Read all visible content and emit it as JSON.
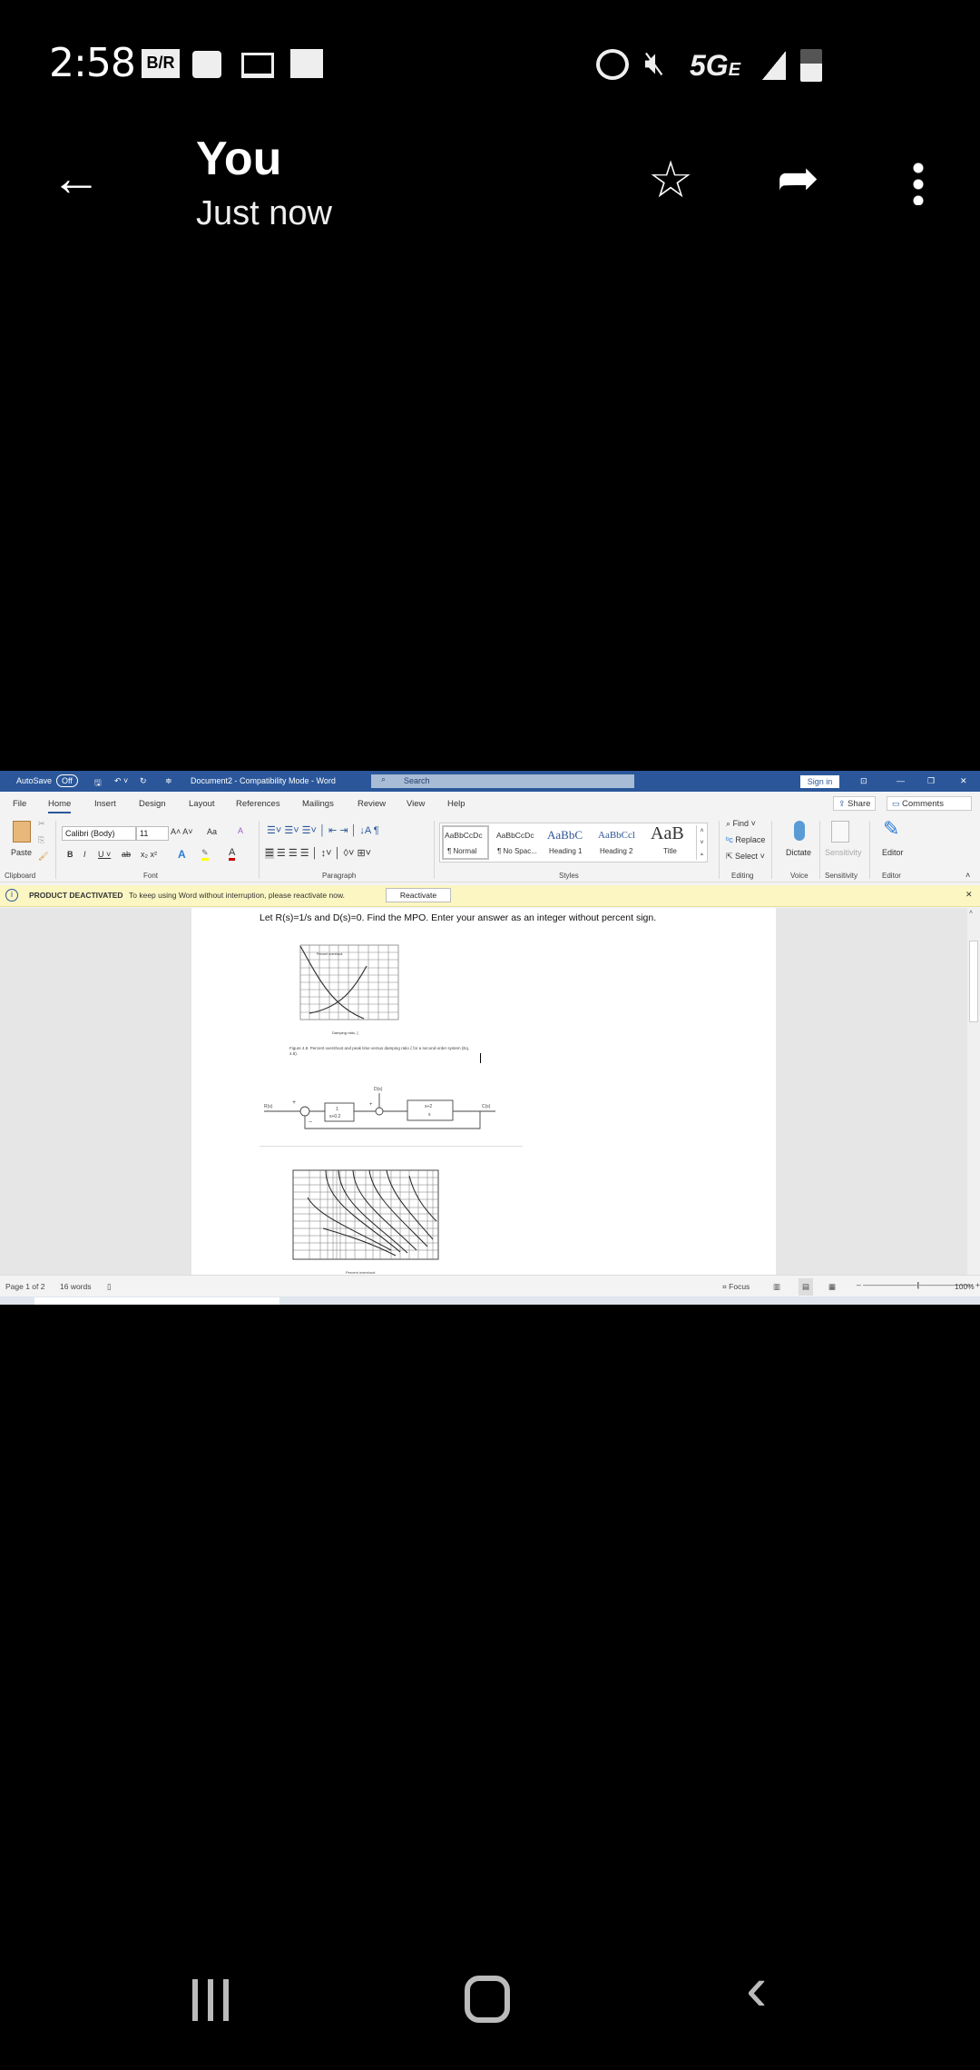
{
  "status_bar": {
    "time": "2:58",
    "network": "5G",
    "network_suffix": "E",
    "icons": [
      "br-app-icon",
      "email-icon",
      "laptop-icon",
      "image-icon",
      "alarm-icon",
      "mute-icon",
      "signal-icon",
      "battery-icon"
    ],
    "br_label": "B/R"
  },
  "header": {
    "title": "You",
    "subtitle": "Just now",
    "icons": [
      "back-arrow-icon",
      "star-icon",
      "forward-icon",
      "more-vert-icon"
    ]
  },
  "word": {
    "titlebar": {
      "autosave": "AutoSave",
      "autosave_state": "Off",
      "doc_title": "Document2  -  Compatibility Mode  -  Word",
      "search": "Search",
      "sign_in": "Sign in"
    },
    "tabs": [
      "File",
      "Home",
      "Insert",
      "Design",
      "Layout",
      "References",
      "Mailings",
      "Review",
      "View",
      "Help"
    ],
    "active_tab": "Home",
    "share": "Share",
    "comments": "Comments",
    "ribbon": {
      "paste": "Paste",
      "font_name": "Calibri (Body)",
      "font_size": "11",
      "change_case": "Aa",
      "groups": [
        "Clipboard",
        "Font",
        "Paragraph",
        "Styles",
        "Editing",
        "Voice",
        "Sensitivity",
        "Editor"
      ],
      "styles": [
        {
          "preview": "AaBbCcDc",
          "label": "¶ Normal"
        },
        {
          "preview": "AaBbCcDc",
          "label": "¶ No Spac..."
        },
        {
          "preview": "AaBbC",
          "label": "Heading 1"
        },
        {
          "preview": "AaBbCcl",
          "label": "Heading 2"
        },
        {
          "preview": "AaB",
          "label": "Title"
        }
      ],
      "editing": [
        "Find",
        "Replace",
        "Select"
      ],
      "dictate": "Dictate",
      "sensitivity": "Sensitivity",
      "editor": "Editor"
    },
    "banner": {
      "title": "PRODUCT DEACTIVATED",
      "message": "To keep using Word without interruption, please reactivate now.",
      "button": "Reactivate"
    },
    "document": {
      "question": "Let R(s)=1/s and D(s)=0. Find the MPO. Enter your answer as an integer without percent sign.",
      "figure1_caption": "Figure 4.8.  Percent overshoot and peak time versus damping ratio ζ for a second-order system (Eq. 4.8).",
      "figure1_xlabel": "Damping ratio, ζ",
      "figure1_curve_label": "Percent overshoot",
      "diagram": {
        "input": "R(s)",
        "disturbance": "D(s)",
        "output": "C(s)",
        "block1_num": "1",
        "block1_den": "s+0.2",
        "block2_num": "s+2",
        "block2_den": "s",
        "plus": "+",
        "minus": "−"
      },
      "figure2_xlabel": "Percent overshoot"
    },
    "statusbar": {
      "page": "Page 1 of 2",
      "words": "16 words",
      "focus": "Focus",
      "zoom": "100%"
    },
    "zoom_level_percent": 100
  },
  "nav": {
    "icons": [
      "recents-icon",
      "home-icon",
      "back-icon"
    ]
  }
}
